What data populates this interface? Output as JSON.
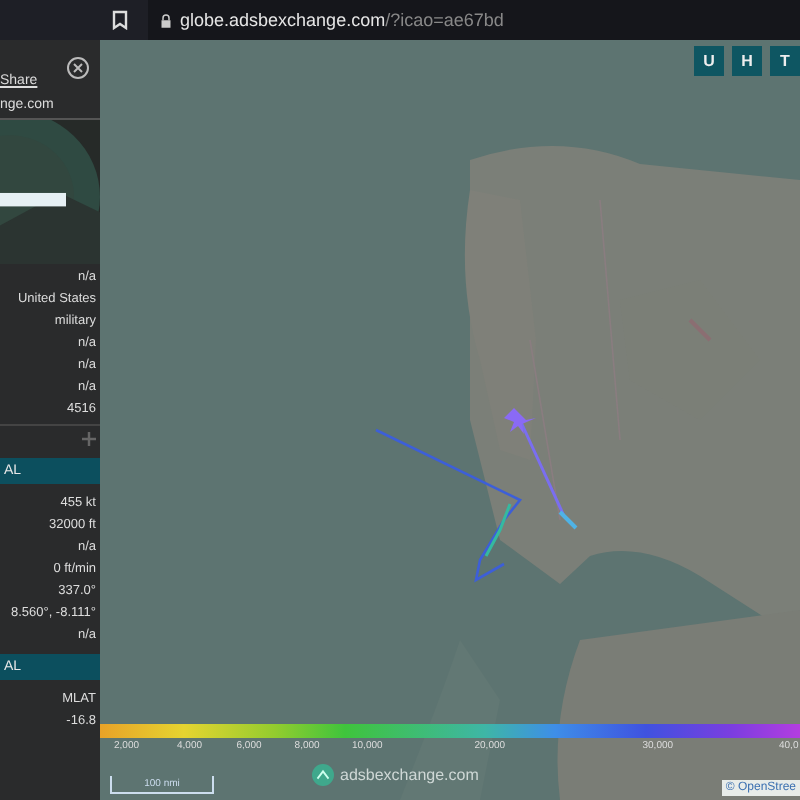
{
  "browser": {
    "url_host": "globe.adsbexchange.com",
    "url_path": "/?icao=ae67bd"
  },
  "sidebar": {
    "share_label": "Share",
    "site_label": "nge.com",
    "blocks": [
      {
        "kind": "values",
        "rows": [
          "n/a",
          "United States",
          "military",
          "n/a",
          "n/a",
          "n/a",
          "4516"
        ]
      },
      {
        "kind": "divider"
      },
      {
        "kind": "header",
        "label": "AL"
      },
      {
        "kind": "values",
        "rows": [
          "455 kt",
          "32000 ft",
          "n/a",
          "0 ft/min",
          "337.0°",
          "8.560°, -8.111°",
          "n/a"
        ]
      },
      {
        "kind": "header",
        "label": "AL"
      },
      {
        "kind": "values",
        "rows": [
          "MLAT",
          "-16.8"
        ]
      }
    ]
  },
  "map": {
    "buttons": [
      "U",
      "H",
      "T"
    ],
    "legend": {
      "labels": [
        "2,000",
        "4,000",
        "6,000",
        "8,000",
        "10,000",
        "20,000",
        "30,000",
        "40,0"
      ]
    },
    "scale_label": "100 nmi",
    "logo_text": "adsbexchange.com",
    "attribution": "© OpenStree"
  }
}
